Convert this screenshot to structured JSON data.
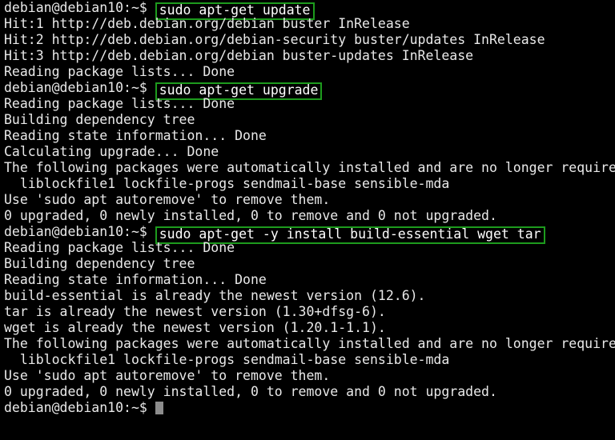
{
  "terminal": {
    "prompt": "debian@debian10:~$ ",
    "background_color": "#000000",
    "text_color": "#e9e9e9",
    "highlight_border_color": "#1d9b1d",
    "cursor_color": "#8d8d8d",
    "cursor_char": " "
  },
  "lines": [
    {
      "type": "command",
      "prompt": "debian@debian10:~$ ",
      "command": "sudo apt-get update"
    },
    {
      "type": "output",
      "text": "Hit:1 http://deb.debian.org/debian buster InRelease"
    },
    {
      "type": "output",
      "text": "Hit:2 http://deb.debian.org/debian-security buster/updates InRelease"
    },
    {
      "type": "output",
      "text": "Hit:3 http://deb.debian.org/debian buster-updates InRelease"
    },
    {
      "type": "output",
      "text": "Reading package lists... Done"
    },
    {
      "type": "command",
      "prompt": "debian@debian10:~$ ",
      "command": "sudo apt-get upgrade"
    },
    {
      "type": "output",
      "text": "Reading package lists... Done"
    },
    {
      "type": "output",
      "text": "Building dependency tree"
    },
    {
      "type": "output",
      "text": "Reading state information... Done"
    },
    {
      "type": "output",
      "text": "Calculating upgrade... Done"
    },
    {
      "type": "output",
      "text": "The following packages were automatically installed and are no longer required:"
    },
    {
      "type": "output",
      "text": "  liblockfile1 lockfile-progs sendmail-base sensible-mda"
    },
    {
      "type": "output",
      "text": "Use 'sudo apt autoremove' to remove them."
    },
    {
      "type": "output",
      "text": "0 upgraded, 0 newly installed, 0 to remove and 0 not upgraded."
    },
    {
      "type": "command",
      "prompt": "debian@debian10:~$ ",
      "command": "sudo apt-get -y install build-essential wget tar"
    },
    {
      "type": "output",
      "text": "Reading package lists... Done"
    },
    {
      "type": "output",
      "text": "Building dependency tree"
    },
    {
      "type": "output",
      "text": "Reading state information... Done"
    },
    {
      "type": "output",
      "text": "build-essential is already the newest version (12.6)."
    },
    {
      "type": "output",
      "text": "tar is already the newest version (1.30+dfsg-6)."
    },
    {
      "type": "output",
      "text": "wget is already the newest version (1.20.1-1.1)."
    },
    {
      "type": "output",
      "text": "The following packages were automatically installed and are no longer required:"
    },
    {
      "type": "output",
      "text": "  liblockfile1 lockfile-progs sendmail-base sensible-mda"
    },
    {
      "type": "output",
      "text": "Use 'sudo apt autoremove' to remove them."
    },
    {
      "type": "output",
      "text": "0 upgraded, 0 newly installed, 0 to remove and 0 not upgraded."
    },
    {
      "type": "prompt-cursor",
      "prompt": "debian@debian10:~$ "
    }
  ]
}
